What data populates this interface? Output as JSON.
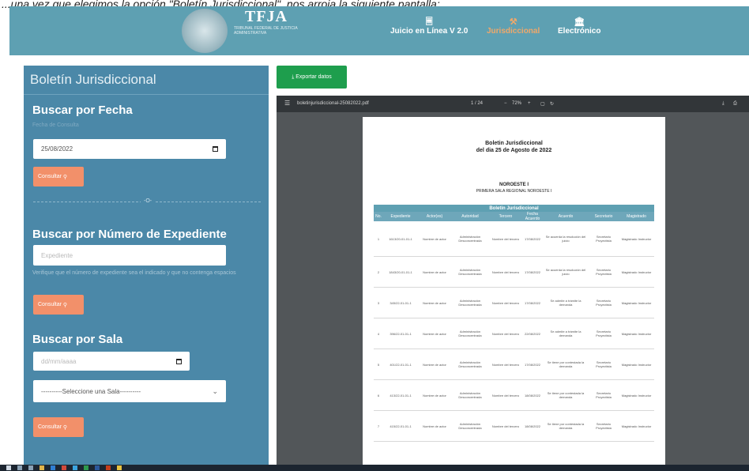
{
  "caption": "...una vez que elegimos la opción \"Boletín Jurisdiccional\", nos arroja la siguiente pantalla:",
  "nav": {
    "brand_logo": "TFJA",
    "brand_sub": "TRIBUNAL FEDERAL DE JUSTICIA ADMINISTRATIVA",
    "items": [
      {
        "icon": "document-icon",
        "label": "Juicio en Línea V 2.0",
        "active": false
      },
      {
        "icon": "gavel-icon",
        "label": "Jurisdiccional",
        "active": true
      },
      {
        "icon": "building-icon",
        "label": "Electrónico",
        "active": false
      }
    ],
    "colors": {
      "bar": "#5ea0b2",
      "active": "#f0a86a"
    }
  },
  "sidebar": {
    "title": "Boletín Jurisdiccional",
    "by_date": {
      "heading": "Buscar por Fecha",
      "label": "Fecha de Consulta",
      "date_value": "25/08/2022",
      "button": "Consultar"
    },
    "divider": "-O-",
    "by_number": {
      "heading": "Buscar por Número de Expediente",
      "placeholder": "Expediente",
      "help": "Verifique que el número de expediente sea el indicado y que no contenga espacios",
      "button": "Consultar"
    },
    "by_sala": {
      "heading": "Buscar por Sala",
      "date_placeholder": "dd/mm/aaaa",
      "select_value": "----------Seleccione una Sala----------",
      "button": "Consultar"
    }
  },
  "export_button": "Exportar datos",
  "viewer": {
    "filename": "boletinjurisdiccional-25082022.pdf",
    "page_indicator": "1 / 24",
    "zoom": "72%",
    "document": {
      "title": "Boletin Jurisdiccional",
      "subtitle": "del dia 25 de Agosto de 2022",
      "region": "NOROESTE I",
      "region_sub": "PRIMERA SALA REGIONAL NOROESTE I",
      "table_title": "Boletin Jurisdiccional",
      "columns": [
        "No.",
        "Expediente",
        "Actor(es)",
        "Autoridad",
        "Tercero",
        "Fecha Acuerdo",
        "Acuerdo",
        "Secretario",
        "Magistrado"
      ],
      "rows": [
        [
          "1",
          "1613/20-01-01-1",
          "Nombre de actor",
          "Administración Desconcentrada",
          "Nombre del tercero",
          "17/08/2022",
          "Se acuerda la resolución del juicio",
          "Secretario Proyectista",
          "Magistrado Instructor"
        ],
        [
          "2",
          "1843/20-01-01-1",
          "Nombre de actor",
          "Administración Desconcentrada",
          "Nombre del tercero",
          "17/08/2022",
          "Se acuerda la resolución del juicio",
          "Secretario Proyectista",
          "Magistrado Instructor"
        ],
        [
          "3",
          "345/22-01-01-1",
          "Nombre de actor",
          "Administración Desconcentrada",
          "Nombre del tercero",
          "17/08/2022",
          "Se admite a trámite la demanda",
          "Secretario Proyectista",
          "Magistrado Instructor"
        ],
        [
          "4",
          "396/22-01-01-1",
          "Nombre de actor",
          "Administración Desconcentrada",
          "Nombre del tercero",
          "22/08/2022",
          "Se admite a trámite la demanda",
          "Secretario Proyectista",
          "Magistrado Instructor"
        ],
        [
          "5",
          "401/22-01-01-1",
          "Nombre de actor",
          "Administración Desconcentrada",
          "Nombre del tercero",
          "17/08/2022",
          "Se tiene por contestada la demanda",
          "Secretario Proyectista",
          "Magistrado Instructor"
        ],
        [
          "6",
          "413/22-01-01-1",
          "Nombre de actor",
          "Administración Desconcentrada",
          "Nombre del tercero",
          "18/08/2022",
          "Se tiene por contestada la demanda",
          "Secretario Proyectista",
          "Magistrado Instructor"
        ],
        [
          "7",
          "415/22-01-01-1",
          "Nombre de actor",
          "Administración Desconcentrada",
          "Nombre del tercero",
          "18/08/2022",
          "Se tiene por contestada la demanda",
          "Secretario Proyectista",
          "Magistrado Instructor"
        ]
      ]
    }
  }
}
